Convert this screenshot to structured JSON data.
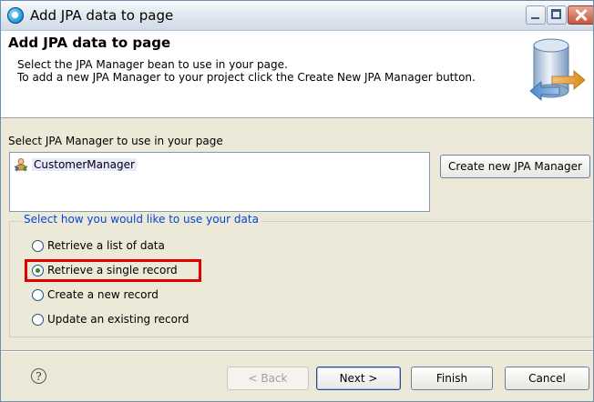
{
  "window": {
    "title": "Add JPA data to page"
  },
  "header": {
    "title": "Add JPA data to page",
    "description_line1": "Select the JPA Manager bean to use in your page.",
    "description_line2": "To add a new JPA Manager to your project click the Create New JPA Manager button."
  },
  "manager_section": {
    "label": "Select JPA Manager to use in your page",
    "items": [
      {
        "label": "CustomerManager",
        "icon": "person-bean-icon"
      }
    ],
    "create_button": "Create new JPA Manager"
  },
  "usage_group": {
    "legend": "Select how you would like to use your data",
    "options": [
      {
        "label": "Retrieve a list of data",
        "checked": false
      },
      {
        "label": "Retrieve a single record",
        "checked": true
      },
      {
        "label": "Create a new record",
        "checked": false
      },
      {
        "label": "Update an existing record",
        "checked": false
      }
    ]
  },
  "footer": {
    "help_icon": "question-mark-icon",
    "help_glyph": "?",
    "back": "< Back",
    "next": "Next >",
    "finish": "Finish",
    "cancel": "Cancel"
  },
  "colors": {
    "highlight": "#e00000",
    "legend": "#0046d5",
    "dialog_bg": "#ECE9D8"
  }
}
